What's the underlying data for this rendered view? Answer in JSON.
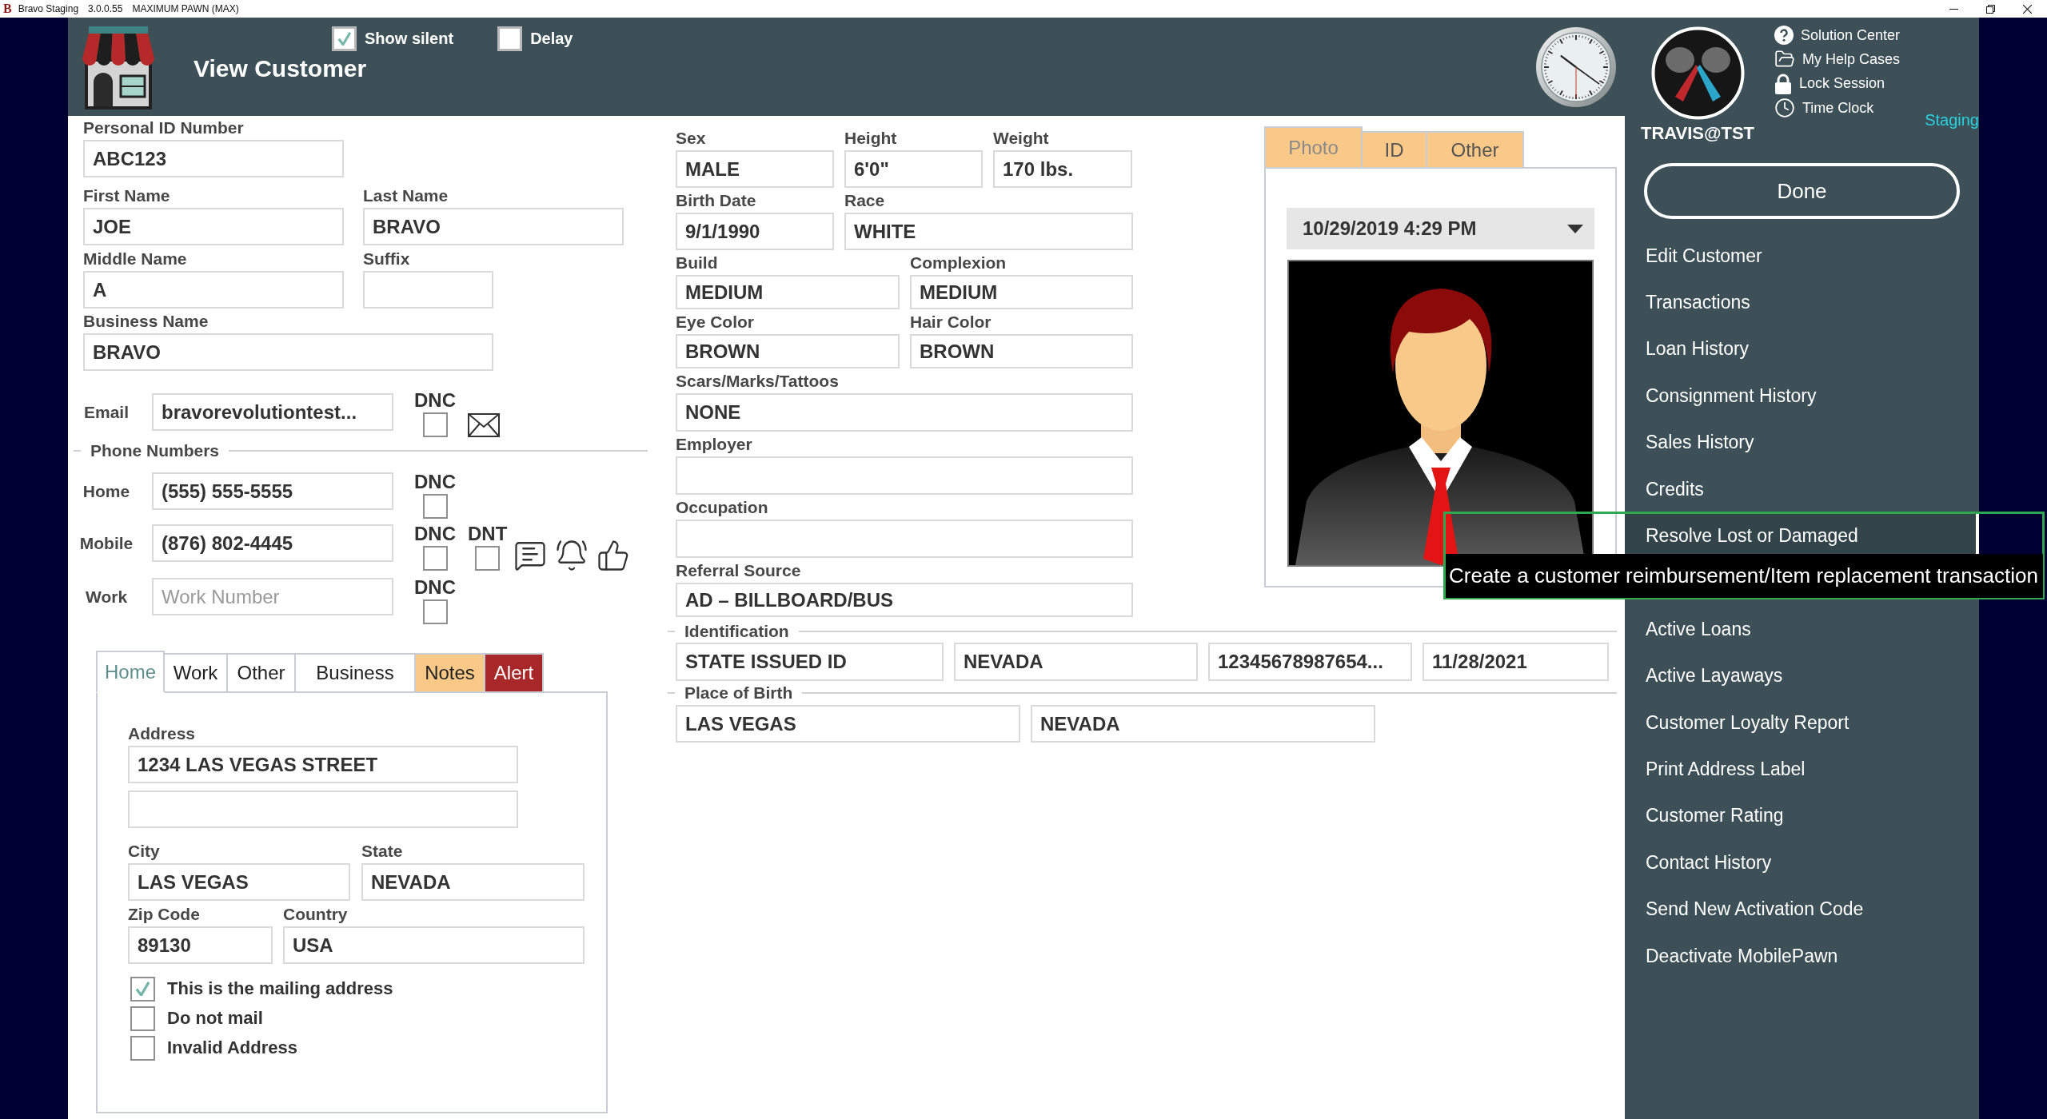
{
  "title_bar": {
    "logo": "B",
    "app_name": "Bravo Staging",
    "version": "3.0.0.55",
    "store": "MAXIMUM PAWN (MAX)"
  },
  "header": {
    "title": "View Customer",
    "toggles": [
      {
        "label": "Show silent",
        "checked": true
      },
      {
        "label": "Delay",
        "checked": false
      }
    ]
  },
  "personal": {
    "rows": [
      [
        {
          "label": "Personal ID Number",
          "value": "ABC123"
        }
      ],
      [
        {
          "label": "First Name",
          "value": "JOE"
        },
        {
          "label": "Last Name",
          "value": "BRAVO"
        }
      ],
      [
        {
          "label": "Middle Name",
          "value": "A"
        },
        {
          "label": "Suffix"
        }
      ],
      [
        {
          "label": "Business Name",
          "value": "BRAVO"
        }
      ]
    ]
  },
  "email": {
    "label": "Email",
    "value": "bravorevolutiontest...",
    "flags": [
      {
        "label": "DNC",
        "checked": false
      }
    ]
  },
  "phones": {
    "title": "Phone Numbers",
    "items": [
      {
        "label": "Home",
        "value": "(555) 555-5555",
        "flags": [
          {
            "label": "DNC",
            "checked": false
          }
        ],
        "message_actions": false
      },
      {
        "label": "Mobile",
        "value": "(876) 802-4445",
        "flags": [
          {
            "label": "DNC",
            "checked": false
          },
          {
            "label": "DNT",
            "checked": false
          }
        ],
        "message_actions": true
      },
      {
        "label": "Work",
        "placeholder": "Work Number",
        "flags": [
          {
            "label": "DNC",
            "checked": false
          }
        ],
        "message_actions": false
      }
    ]
  },
  "address_tabs": [
    {
      "label": "Home",
      "selected": true
    },
    {
      "label": "Work",
      "selected": false
    },
    {
      "label": "Other",
      "selected": false
    },
    {
      "label": "Business",
      "selected": false
    },
    {
      "label": "Notes",
      "selected": false,
      "color": "#fbc987"
    },
    {
      "label": "Alert",
      "selected": false,
      "color": "#a8282a"
    }
  ],
  "address": {
    "label": "Address",
    "line_1": "1234 LAS VEGAS STREET",
    "rows": [
      [
        {
          "label": "City",
          "value": "LAS VEGAS"
        },
        {
          "label": "State",
          "value": "NEVADA"
        }
      ],
      [
        {
          "label": "Zip Code",
          "value": "89130"
        },
        {
          "label": "Country",
          "value": "USA"
        }
      ]
    ],
    "options": [
      {
        "label": "This is the mailing address",
        "checked": true
      },
      {
        "label": "Do not mail",
        "checked": false
      },
      {
        "label": "Invalid Address",
        "checked": false
      }
    ]
  },
  "description": {
    "rows": [
      [
        {
          "label": "Sex",
          "value": "MALE"
        },
        {
          "label": "Height",
          "value": "6'0\""
        },
        {
          "label": "Weight",
          "value": "170 lbs."
        }
      ],
      [
        {
          "label": "Birth Date",
          "value": "9/1/1990"
        },
        {
          "label": "Race",
          "value": "WHITE"
        }
      ],
      [
        {
          "label": "Build",
          "value": "MEDIUM"
        },
        {
          "label": "Complexion",
          "value": "MEDIUM"
        }
      ],
      [
        {
          "label": "Eye Color",
          "value": "BROWN"
        },
        {
          "label": "Hair Color",
          "value": "BROWN"
        }
      ],
      [
        {
          "label": "Scars/Marks/Tattoos",
          "value": "NONE"
        }
      ],
      [
        {
          "label": "Employer"
        }
      ],
      [
        {
          "label": "Occupation"
        }
      ],
      [
        {
          "label": "Referral Source",
          "value": "AD – BILLBOARD/BUS"
        }
      ]
    ]
  },
  "identification": {
    "title": "Identification",
    "values": [
      "STATE ISSUED ID",
      "NEVADA",
      "12345678987654...",
      "11/28/2021"
    ]
  },
  "place_of_birth": {
    "title": "Place of Birth",
    "values": [
      "LAS VEGAS",
      "NEVADA"
    ]
  },
  "photo_panel": {
    "tabs": [
      {
        "label": "Photo",
        "selected": true
      },
      {
        "label": "ID",
        "selected": false
      },
      {
        "label": "Other",
        "selected": false
      }
    ],
    "date": "10/29/2019 4:29 PM"
  },
  "user": {
    "name": "TRAVIS@TST",
    "environment": "Staging",
    "links": [
      {
        "label": "Solution Center",
        "kind": "help"
      },
      {
        "label": "My Help Cases",
        "kind": "folder"
      },
      {
        "label": "Lock Session",
        "kind": "lock"
      },
      {
        "label": "Time Clock",
        "kind": "clock"
      }
    ]
  },
  "sidebar": {
    "done": "Done",
    "items": [
      {
        "label": "Edit Customer",
        "hovered": false
      },
      {
        "label": "Transactions",
        "hovered": false
      },
      {
        "label": "Loan History",
        "hovered": false
      },
      {
        "label": "Consignment History",
        "hovered": false
      },
      {
        "label": "Sales History",
        "hovered": false
      },
      {
        "label": "Credits",
        "hovered": false
      },
      {
        "label": "Resolve Lost or Damaged",
        "hovered": true,
        "tooltip": "Create a customer reimbursement/Item replacement transaction"
      },
      {
        "label": "Active Loans",
        "hovered": false
      },
      {
        "label": "Active Layaways",
        "hovered": false
      },
      {
        "label": "Customer Loyalty Report",
        "hovered": false
      },
      {
        "label": "Print Address Label",
        "hovered": false
      },
      {
        "label": "Customer Rating",
        "hovered": false
      },
      {
        "label": "Contact History",
        "hovered": false
      },
      {
        "label": "Send New Activation Code",
        "hovered": false
      },
      {
        "label": "Deactivate MobilePawn",
        "hovered": false
      }
    ]
  }
}
